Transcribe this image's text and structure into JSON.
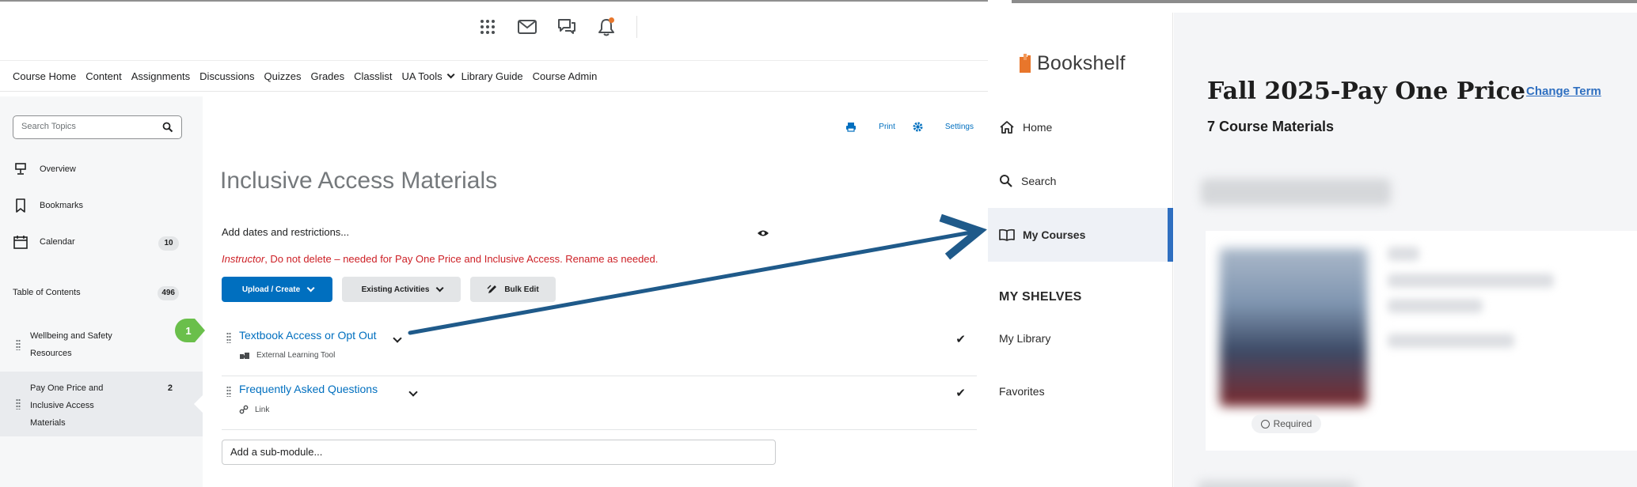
{
  "lms": {
    "top_icons": [
      "apps-grid-icon",
      "mail-icon",
      "chat-icon",
      "bell-icon"
    ],
    "nav": [
      "Course Home",
      "Content",
      "Assignments",
      "Discussions",
      "Quizzes",
      "Grades",
      "Classlist",
      "UA Tools",
      "Library Guide",
      "Course Admin"
    ],
    "sidebar": {
      "search_placeholder": "Search Topics",
      "overview": "Overview",
      "bookmarks": "Bookmarks",
      "calendar": "Calendar",
      "calendar_count": "10",
      "toc": "Table of Contents",
      "toc_count": "496",
      "module1": "Wellbeing and Safety Resources",
      "module2": "Pay One Price and Inclusive Access Materials",
      "module2_count": "2"
    },
    "main": {
      "print": "Print",
      "settings": "Settings",
      "title": "Inclusive Access Materials",
      "add_dates": "Add dates and restrictions...",
      "warning_instructor": "Instructor",
      "warning_rest": ", Do not delete – needed for Pay One Price and Inclusive Access.  Rename as needed.",
      "btn_upload": "Upload / Create",
      "btn_existing": "Existing Activities",
      "btn_bulk": "Bulk Edit",
      "activities": [
        {
          "title": "Textbook Access or Opt Out",
          "type": "External Learning Tool"
        },
        {
          "title": "Frequently Asked Questions",
          "type": "Link"
        }
      ],
      "add_submodule": "Add a sub-module..."
    },
    "step_badge": "1"
  },
  "bookshelf": {
    "logo": "Bookshelf",
    "nav": {
      "home": "Home",
      "search": "Search",
      "my_courses": "My Courses",
      "my_shelves": "MY SHELVES",
      "my_library": "My Library",
      "favorites": "Favorites"
    },
    "term_title": "Fall 2025-Pay One Price",
    "change_term": "Change Term",
    "materials_count": "7 Course Materials",
    "required": "Required"
  },
  "colors": {
    "lms_accent": "#006fbf",
    "warning": "#cd2026",
    "step_badge": "#6abf4b",
    "arrow": "#1f5a8a",
    "bookshelf_accent": "#2f6fc0",
    "bookshelf_logo": "#e8762b"
  }
}
